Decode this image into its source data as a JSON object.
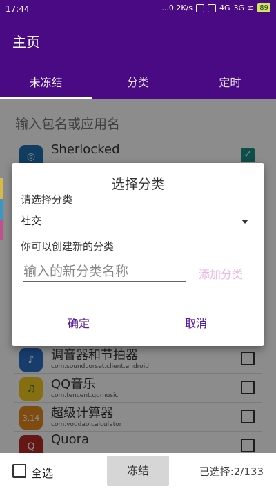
{
  "status": {
    "time": "17:44",
    "speed": "...0.2K/s",
    "net1": "4G",
    "net2": "3G",
    "battery": "89"
  },
  "app": {
    "title": "主页"
  },
  "tabs": [
    {
      "label": "未冻结",
      "active": true
    },
    {
      "label": "分类",
      "active": false
    },
    {
      "label": "定时",
      "active": false
    }
  ],
  "search": {
    "placeholder": "输入包名或应用名"
  },
  "apps": [
    {
      "name": "Sherlocked",
      "pkg": "",
      "icon": "sherlock-icon",
      "icon_color": "#1e6fb0",
      "checked": true
    },
    {
      "name": "调音器和节拍器",
      "pkg": "com.soundcorset.client.android",
      "icon": "tuner-icon",
      "icon_color": "#2a6fc7",
      "checked": false
    },
    {
      "name": "QQ音乐",
      "pkg": "com.tencent.qqmusic",
      "icon": "qqmusic-icon",
      "icon_color": "#f4cb1e",
      "checked": false
    },
    {
      "name": "超级计算器",
      "pkg": "com.youdao.calculator",
      "icon": "calculator-icon",
      "icon_color": "#e68a1f",
      "icon_text": "3.14",
      "checked": false
    },
    {
      "name": "Quora",
      "pkg": "",
      "icon": "quora-icon",
      "icon_color": "#b92b27",
      "icon_text": "Q",
      "checked": false
    }
  ],
  "bottom": {
    "select_all": "全选",
    "freeze": "冻结",
    "count": "已选择:2/133"
  },
  "dialog": {
    "title": "选择分类",
    "choose_label": "请选择分类",
    "selected": "社交",
    "create_label": "你可以创建新的分类",
    "new_placeholder": "输入的新分类名称",
    "add_button": "添加分类",
    "ok": "确定",
    "cancel": "取消"
  },
  "colors": {
    "primary": "#4a0a84",
    "accent": "#1b8f86",
    "dialog_button": "#5a1aa0"
  }
}
